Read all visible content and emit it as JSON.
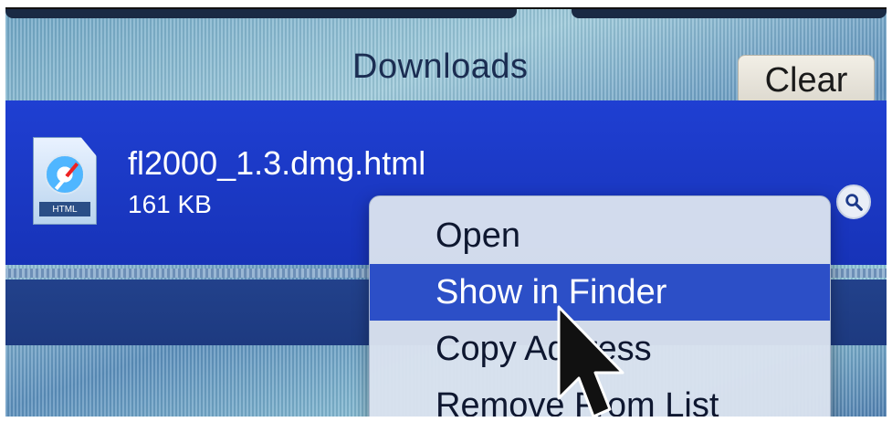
{
  "header": {
    "title": "Downloads",
    "clear_label": "Clear"
  },
  "download": {
    "filename": "fl2000_1.3.dmg.html",
    "size": "161 KB",
    "file_type_label": "HTML",
    "icon": "safari-compass-icon",
    "action_icon": "magnifier-icon"
  },
  "context_menu": {
    "items": [
      {
        "label": "Open",
        "highlighted": false
      },
      {
        "label": "Show in Finder",
        "highlighted": true
      },
      {
        "label": "Copy Address",
        "highlighted": false
      },
      {
        "label": "Remove From List",
        "highlighted": false
      }
    ]
  },
  "colors": {
    "selection": "#1f3fd2",
    "menu_highlight": "#2c4fc7",
    "menu_background": "#dae2ee"
  }
}
